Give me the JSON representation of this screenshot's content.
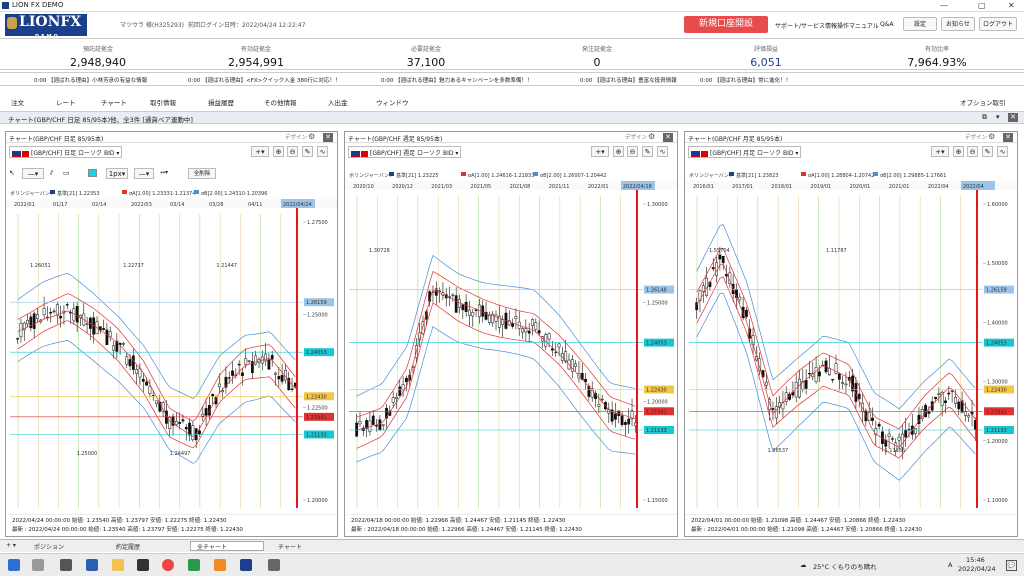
{
  "window": {
    "title": "LION FX DEMO"
  },
  "header": {
    "user": "マツウラ 様(H325293)",
    "last_login": "前回ログイン日時：2022/04/24 12:22:47",
    "new_account": "新規口座開設",
    "links": [
      "サポート/サービス情報",
      "操作マニュアル",
      "Q&A"
    ],
    "buttons": [
      "設定",
      "お知らせ",
      "ログアウト"
    ]
  },
  "summary": [
    {
      "label": "預託証拠金",
      "value": "2,948,940"
    },
    {
      "label": "有効証拠金",
      "value": "2,954,991"
    },
    {
      "label": "必要証拠金",
      "value": "37,100"
    },
    {
      "label": "発注証拠金",
      "value": "0"
    },
    {
      "label": "評価損益",
      "value": "6,051"
    },
    {
      "label": "有効比率",
      "value": "7,964.93%"
    }
  ],
  "ticker": [
    "0:00 【週ばれる理由】小林芳彦の有益な情報",
    "0:00 【週ばれる理由】<FX>クイック入金 380行に対応！！",
    "0:00 【週ばれる理由】魅力あるキャンペーンを多数準備！！",
    "0:00 【週ばれる理由】豊富な投資情報",
    "0:00 【週ばれる理由】常に進化！！"
  ],
  "menu": [
    "注文",
    "レート",
    "チャート",
    "取引情報",
    "損益履歴",
    "その他情報",
    "入出金",
    "ウィンドウ"
  ],
  "menu_right": "オプション取引",
  "chart_bar_title": "チャート(GBP/CHF 日足 85/95本)他、全3件 [通貨ペア連動中]",
  "panels": [
    {
      "title": "チャート(GBP/CHF 日足 85/95本)",
      "symbol": "[GBP/CHF] 日足 ローソク BID",
      "design": "デザイン",
      "bb_label": "ボリンジャーバンド",
      "bb_items": [
        "基準[21] 1.22353",
        "σA[1.00] 1.23331-1.21374",
        "σB[2.00] 1.24310-1.20396"
      ],
      "dates": [
        "2022/01",
        "01/17",
        "02/14",
        "2022/03",
        "03/14",
        "03/28",
        "04/11"
      ],
      "current_date": "2022/04/24",
      "yticks": [
        "1.27500",
        "1.25000",
        "1.22500",
        "1.20000"
      ],
      "price_tags": [
        "1.26159",
        "1.24053",
        "1.22430",
        "1.21941",
        "1.21133"
      ],
      "annotations": [
        "1.26051",
        "1.25000",
        "1.22737",
        "1.24497",
        "1.21447"
      ],
      "foot1": "2022/04/24 00:00:00 始値: 1.23540 高値: 1.23797 安値: 1.22275 終値: 1.22430",
      "foot2": "最新 : 2022/04/24 00:00:00 始値: 1.23540 高値: 1.23797 安値: 1.22275 終値: 1.22430",
      "tool_size": "1px",
      "clear": "全削除"
    },
    {
      "title": "チャート(GBP/CHF 週足 85/95本)",
      "symbol": "[GBP/CHF] 週足 ローソク BID",
      "design": "デザイン",
      "bb_label": "ボリンジャーバンド",
      "bb_items": [
        "基準[21] 1.23225",
        "σA[1.00] 1.24616-1.21833",
        "σB[2.00] 1.26007-1.20442"
      ],
      "dates": [
        "2020/10",
        "2020/12",
        "2021/03",
        "2021/05",
        "2021/08",
        "2021/11",
        "2022/01"
      ],
      "current_date": "2022/04/18",
      "yticks": [
        "1.30000",
        "1.25000",
        "1.20000",
        "1.15000"
      ],
      "price_tags": [
        "1.26148",
        "1.24053",
        "1.22430",
        "1.21941",
        "1.21133"
      ],
      "annotations": [
        "1.30728"
      ],
      "foot1": "2022/04/18 00:00:00 始値: 1.22966 高値: 1.24467 安値: 1.21145 終値: 1.22430",
      "foot2": "最新 : 2022/04/18 00:00:00 始値: 1.22966 高値: 1.24467 安値: 1.21145 終値: 1.22430"
    },
    {
      "title": "チャート(GBP/CHF 月足 85/95本)",
      "symbol": "[GBP/CHF] 月足 ローソク BID",
      "design": "デザイン",
      "bb_label": "ボリンジャーバンド",
      "bb_items": [
        "基準[21] 1.23823",
        "σA[1.00] 1.28804-1.20742",
        "σB[2.00] 1.29885-1.17661"
      ],
      "dates": [
        "2016/01",
        "2017/01",
        "2018/01",
        "2019/01",
        "2020/01",
        "2021/01",
        "2022/04"
      ],
      "current_date": "2022/04",
      "yticks": [
        "1.60000",
        "1.50000",
        "1.40000",
        "1.30000",
        "1.20000",
        "1.10000"
      ],
      "price_tags": [
        "1.26159",
        "1.24053",
        "1.22430",
        "1.21941",
        "1.21133"
      ],
      "annotations": [
        "1.55704",
        "1.36537",
        "1.11787",
        "1.11136"
      ],
      "foot1": "2022/04/01 00:00:00 始値: 1.21098 高値: 1.24467 安値: 1.20866 終値: 1.22430",
      "foot2": "最新 : 2022/04/01 00:00:00 始値: 1.21098 高値: 1.24467 安値: 1.20866 終値: 1.22430"
    }
  ],
  "bottom_tabs": [
    "ポジション",
    "約定履歴",
    "全チャート",
    "チャート"
  ],
  "taskbar": {
    "weather": "25°C くもりのち晴れ",
    "time": "15:46",
    "date": "2022/04/24",
    "ime": "A"
  },
  "colors": {
    "accent_blue": "#1b3f8b",
    "red": "#e74c4c",
    "up": "#ffffff",
    "down": "#000000",
    "band_red": "#d33",
    "band_blue": "#4a8fd6",
    "vert_line": "#e01818"
  }
}
